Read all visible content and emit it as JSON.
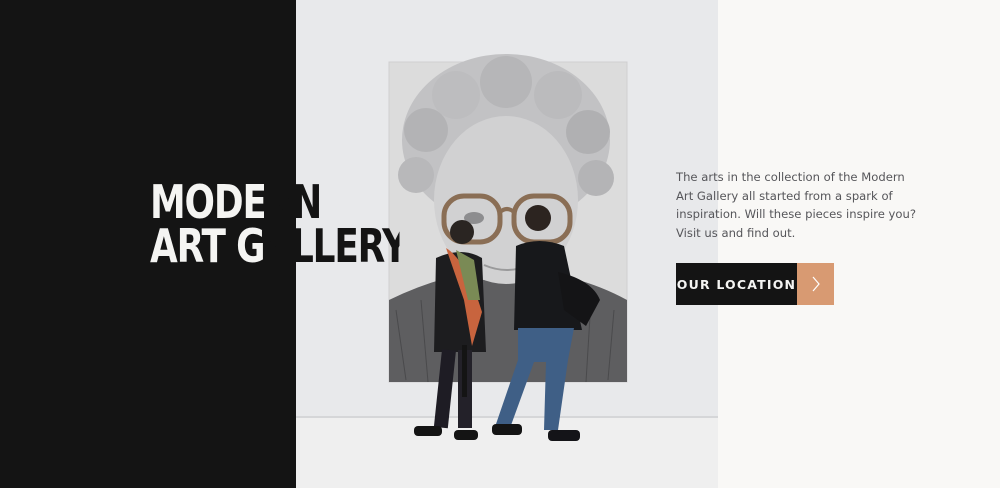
{
  "hero": {
    "title_line1": "MODERN",
    "title_line2": "ART GALLERY",
    "description": "The arts in the collection of the Modern Art Gallery all started from a spark of inspiration. Will these pieces inspire you? Visit us and find out.",
    "cta_label": "OUR LOCATION",
    "cta_icon": "chevron-right-icon",
    "image_subject": "gallery-visitors-viewing-portrait-painting"
  },
  "colors": {
    "dark_panel": "#141414",
    "light_panel": "#f9f8f6",
    "accent": "#d89a72",
    "text_light": "#f4f4f2",
    "body_text": "#56565a"
  }
}
